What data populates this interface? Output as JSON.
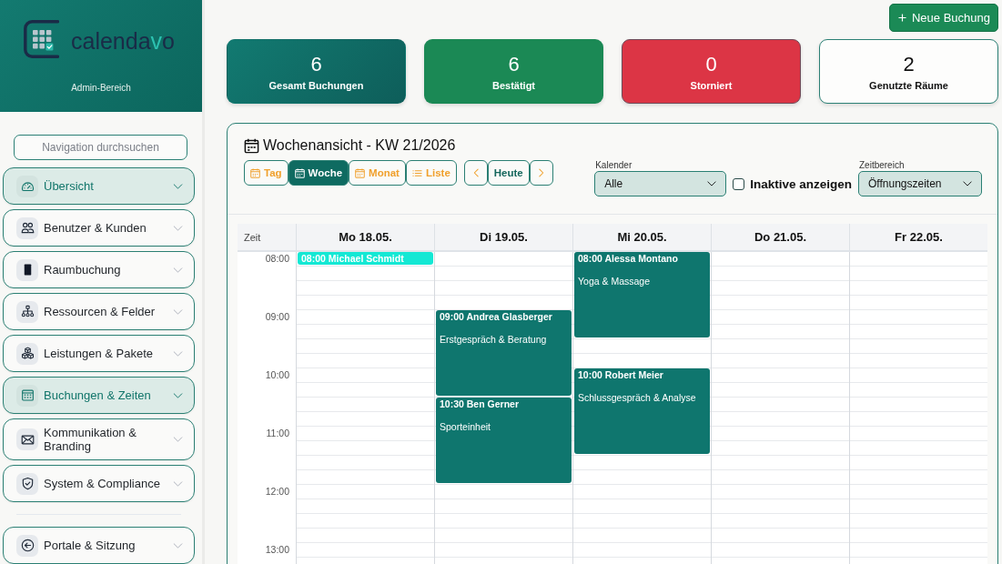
{
  "sidebar": {
    "brand": [
      {
        "text": "calenda",
        "accent": false
      },
      {
        "text": "v",
        "accent": true
      },
      {
        "text": "o",
        "accent": false
      }
    ],
    "subtitle": "Admin-Bereich",
    "search": {
      "placeholder": "Navigation durchsuchen"
    },
    "items": [
      {
        "label": "Übersicht",
        "selected": true
      },
      {
        "label": "Benutzer & Kunden",
        "selected": false
      },
      {
        "label": "Raumbuchung",
        "selected": false
      },
      {
        "label": "Ressourcen & Felder",
        "selected": false
      },
      {
        "label": "Leistungen & Pakete",
        "selected": false
      },
      {
        "label": "Buchungen & Zeiten",
        "selected": true
      },
      {
        "label": "Kommunikation & Branding",
        "selected": false
      },
      {
        "label": "System & Compliance",
        "selected": false
      }
    ],
    "footer_items": [
      {
        "label": "Portale & Sitzung",
        "selected": false
      }
    ]
  },
  "header": {
    "new_button": "Neue Buchung"
  },
  "stats": [
    {
      "value": "6",
      "label": "Gesamt Buchungen",
      "kind": "total"
    },
    {
      "value": "6",
      "label": "Bestätigt",
      "kind": "confirmed"
    },
    {
      "value": "0",
      "label": "Storniert",
      "kind": "cancelled"
    },
    {
      "value": "2",
      "label": "Genutzte Räume",
      "kind": "neutral"
    }
  ],
  "calendar": {
    "title": "Wochenansicht - KW 21/2026",
    "views": [
      {
        "label": "Tag",
        "kind": "calendar",
        "selected": false
      },
      {
        "label": "Woche",
        "kind": "calendar",
        "selected": true
      },
      {
        "label": "Monat",
        "kind": "calendar",
        "selected": false
      },
      {
        "label": "Liste",
        "kind": "list",
        "selected": false
      }
    ],
    "today": "Heute",
    "filters": {
      "calendar": {
        "label": "Kalender",
        "value": "Alle"
      },
      "show_inactive": {
        "label": "Inaktive anzeigen",
        "checked": false
      },
      "time_range": {
        "label": "Zeitbereich",
        "value": "Öffnungszeiten"
      }
    },
    "time_header": "Zeit",
    "time_labels": [
      "08:00",
      "09:00",
      "10:00",
      "11:00",
      "12:00",
      "13:00"
    ],
    "days": [
      {
        "label": "Mo 18.05.",
        "events": [
          {
            "kind": "compact",
            "time": "08:00",
            "name": "Michael Schmidt",
            "color": "#14e8d4"
          }
        ]
      },
      {
        "label": "Di 19.05.",
        "events": [
          {
            "kind": "block",
            "time": "09:00",
            "name": "Andrea Glasberger",
            "service": "Erstgespräch & Beratung",
            "color": "#0f766e"
          },
          {
            "kind": "block",
            "time": "10:30",
            "name": "Ben Gerner",
            "service": "Sporteinheit",
            "color": "#0f766e"
          }
        ]
      },
      {
        "label": "Mi 20.05.",
        "events": [
          {
            "kind": "block",
            "time": "08:00",
            "name": "Alessa Montano",
            "service": "Yoga & Massage",
            "color": "#0f766e"
          },
          {
            "kind": "block",
            "time": "10:00",
            "name": "Robert Meier",
            "service": "Schlussgespräch & Analyse",
            "color": "#0f766e"
          }
        ]
      },
      {
        "label": "Do 21.05."
      },
      {
        "label": "Fr 22.05."
      }
    ]
  }
}
